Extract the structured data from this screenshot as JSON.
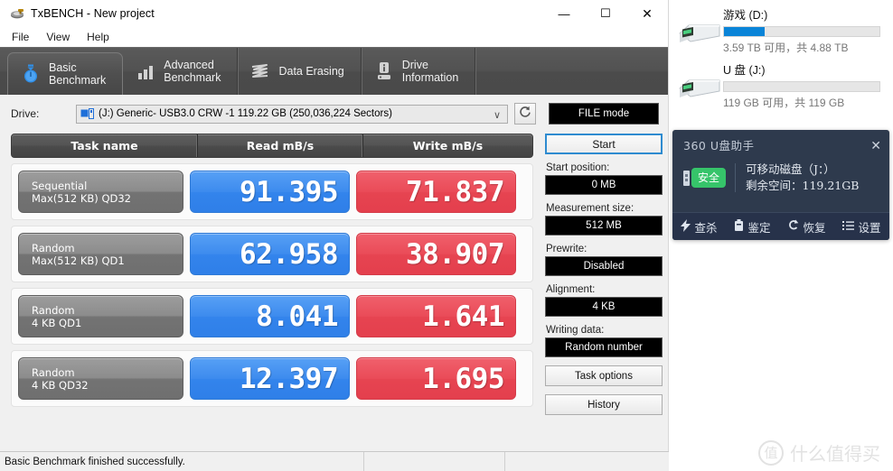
{
  "window": {
    "title": "TxBENCH - New project",
    "icon": "txbench-app-icon",
    "minimize": "—",
    "maximize": "☐",
    "close": "✕"
  },
  "menubar": {
    "items": [
      "File",
      "View",
      "Help"
    ]
  },
  "tabs": [
    {
      "label": "Basic\nBenchmark",
      "icon": "stopwatch-icon",
      "active": true
    },
    {
      "label": "Advanced\nBenchmark",
      "icon": "bar-chart-icon",
      "active": false
    },
    {
      "label": "Data Erasing",
      "icon": "eraser-wave-icon",
      "active": false
    },
    {
      "label": "Drive\nInformation",
      "icon": "drive-info-icon",
      "active": false
    }
  ],
  "drive_bar": {
    "label": "Drive:",
    "selected": "(J:) Generic- USB3.0 CRW   -1  119.22 GB (250,036,224 Sectors)",
    "caret": "∨",
    "refresh_icon": "refresh-icon",
    "file_mode": "FILE mode"
  },
  "results": {
    "headers": [
      "Task name",
      "Read mB/s",
      "Write mB/s"
    ],
    "rows": [
      {
        "name_line1": "Sequential",
        "name_line2": "Max(512 KB) QD32",
        "read": "91.395",
        "write": "71.837"
      },
      {
        "name_line1": "Random",
        "name_line2": "Max(512 KB) QD1",
        "read": "62.958",
        "write": "38.907"
      },
      {
        "name_line1": "Random",
        "name_line2": "4 KB QD1",
        "read": "8.041",
        "write": "1.641"
      },
      {
        "name_line1": "Random",
        "name_line2": "4 KB QD32",
        "read": "12.397",
        "write": "1.695"
      }
    ]
  },
  "side_panel": {
    "start_button": "Start",
    "fields": [
      {
        "label": "Start position:",
        "value": "0 MB"
      },
      {
        "label": "Measurement size:",
        "value": "512 MB"
      },
      {
        "label": "Prewrite:",
        "value": "Disabled"
      },
      {
        "label": "Alignment:",
        "value": "4 KB"
      },
      {
        "label": "Writing data:",
        "value": "Random number"
      }
    ],
    "task_options": "Task options",
    "history": "History"
  },
  "statusbar": {
    "message": "Basic Benchmark finished successfully."
  },
  "explorer_drives": [
    {
      "name": "游戏 (D:)",
      "sub": "3.59 TB 可用，共 4.88 TB",
      "used_percent": 26,
      "icon": "hard-drive-icon"
    },
    {
      "name": "U 盘 (J:)",
      "sub": "119 GB 可用，共 119 GB",
      "used_percent": 0,
      "icon": "hard-drive-icon"
    }
  ],
  "popup_360": {
    "title": "360 U盘助手",
    "close": "✕",
    "badge": "安全",
    "line1": "可移动磁盘（J：）",
    "line2": "剩余空间：119.21GB",
    "actions": [
      {
        "label": "查杀",
        "icon": "lightning-icon"
      },
      {
        "label": "鉴定",
        "icon": "usb-stick-icon"
      },
      {
        "label": "恢复",
        "icon": "undo-arrow-icon"
      },
      {
        "label": "设置",
        "icon": "list-settings-icon"
      }
    ]
  },
  "watermark": {
    "mark": "值",
    "text": "什么值得买"
  },
  "colors": {
    "read_blue": "#3d8bee",
    "write_red": "#ea4b58",
    "accent_blue": "#2e8bd0",
    "explorer_bar": "#0a84d8",
    "safe_green": "#36c46a"
  }
}
